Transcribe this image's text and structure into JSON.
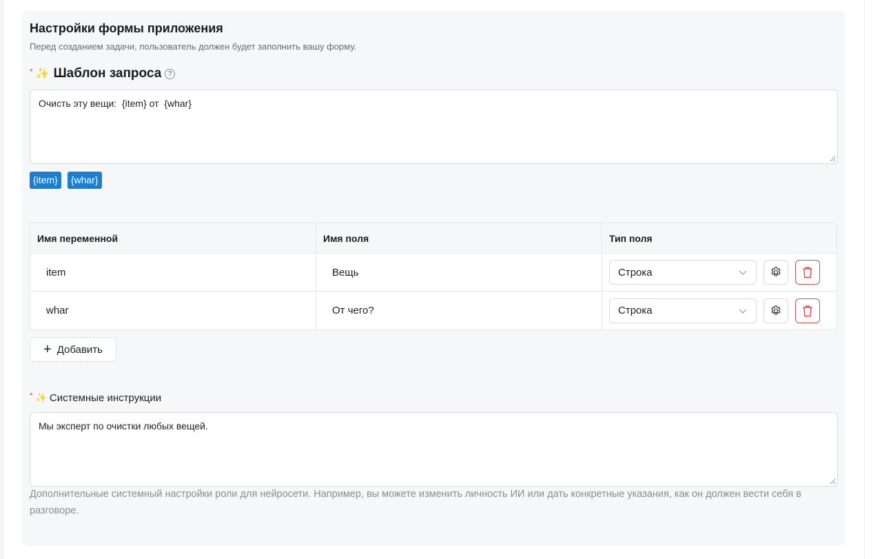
{
  "form": {
    "title": "Настройки формы приложения",
    "subtitle": "Перед созданием задачи, пользователь должен будет заполнить вашу форму."
  },
  "prompt_template": {
    "required_mark": "*",
    "spark_icon": "sparkles-icon",
    "label": "Шаблон запроса",
    "help_icon": "question-circle-icon",
    "value": "Очисть эту вещи:  {item} от  {whar}",
    "tags": [
      "{item}",
      "{whar}"
    ],
    "tag_color": "#1a7fd4"
  },
  "variables_table": {
    "headers": [
      "Имя переменной",
      "Имя поля",
      "Тип поля"
    ],
    "rows": [
      {
        "variable": "item",
        "field_name": "Вещь",
        "field_type": "Строка"
      },
      {
        "variable": "whar",
        "field_name": "От чего?",
        "field_type": "Строка"
      }
    ],
    "settings_icon": "gear-icon",
    "delete_icon": "trash-icon",
    "danger_color": "#e5484d"
  },
  "add_button": {
    "icon": "plus-icon",
    "label": "Добавить"
  },
  "system_instructions": {
    "required_mark": "*",
    "label": "Системные инструкции",
    "value": "Мы эксперт по очистки любых вещей.",
    "hint": "Дополнительные системный настройки роли для нейросети. Например, вы можете изменить личность ИИ или дать конкретные указания, как он должен вести себя в разговоре."
  }
}
